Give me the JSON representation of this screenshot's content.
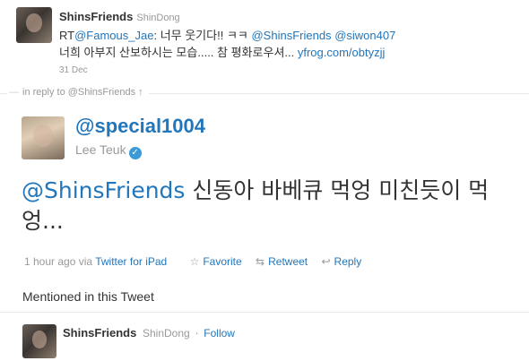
{
  "reply_tweet": {
    "screen_name": "ShinsFriends",
    "full_name": "ShinDong",
    "text_prefix": "RT",
    "mention1": "@Famous_Jae",
    "text_part1": ": 너무 웃기다!! ㅋㅋ ",
    "mention2": "@ShinsFriends",
    "mention3": "@siwon407",
    "text_part2": " 너희 아부지 산보하시는 모습..... 참 평화로우셔... ",
    "link": "yfrog.com/obtyzjj",
    "time": "31 Dec"
  },
  "in_reply": {
    "label": "in reply to @ShinsFriends",
    "arrow": "↑"
  },
  "main_tweet": {
    "handle": "@special1004",
    "name": "Lee Teuk",
    "verified_icon": "✓",
    "mention": "@ShinsFriends",
    "text": " 신동아 바베큐 먹엉 미친듯이 먹엉...",
    "time": "1 hour ago",
    "via": "via",
    "client": "Twitter for iPad",
    "favorite": "Favorite",
    "retweet": "Retweet",
    "reply": "Reply",
    "icons": {
      "favorite": "star-icon",
      "retweet": "retweet-icon",
      "reply": "reply-icon"
    }
  },
  "mentioned": {
    "title": "Mentioned in this Tweet",
    "user": {
      "screen_name": "ShinsFriends",
      "full_name": "ShinDong",
      "separator": "·",
      "follow": "Follow"
    }
  },
  "colors": {
    "link": "#2276bb",
    "muted": "#999999",
    "text": "#333333"
  }
}
